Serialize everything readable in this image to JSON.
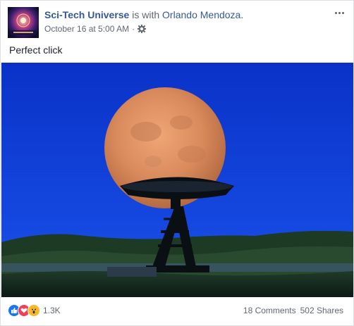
{
  "post": {
    "page_name": "Sci-Tech Universe",
    "with_text": "is with",
    "tagged_person": "Orlando Mendoza.",
    "timestamp": "October 16 at 5:00 AM",
    "separator": "·",
    "body_text": "Perfect click"
  },
  "icons": {
    "avatar": "page-avatar-galaxy",
    "privacy": "gear-icon",
    "more": "more-options-icon"
  },
  "footer": {
    "reaction_count": "1.3K",
    "comments": "18 Comments",
    "shares": "502 Shares",
    "reactions": [
      "like",
      "love",
      "wow"
    ]
  },
  "colors": {
    "link": "#365899",
    "like": "#1877f2",
    "love": "#f33e58",
    "wow": "#f7b928",
    "sky": "#0f3fd6",
    "moon": "#d98a5c"
  }
}
